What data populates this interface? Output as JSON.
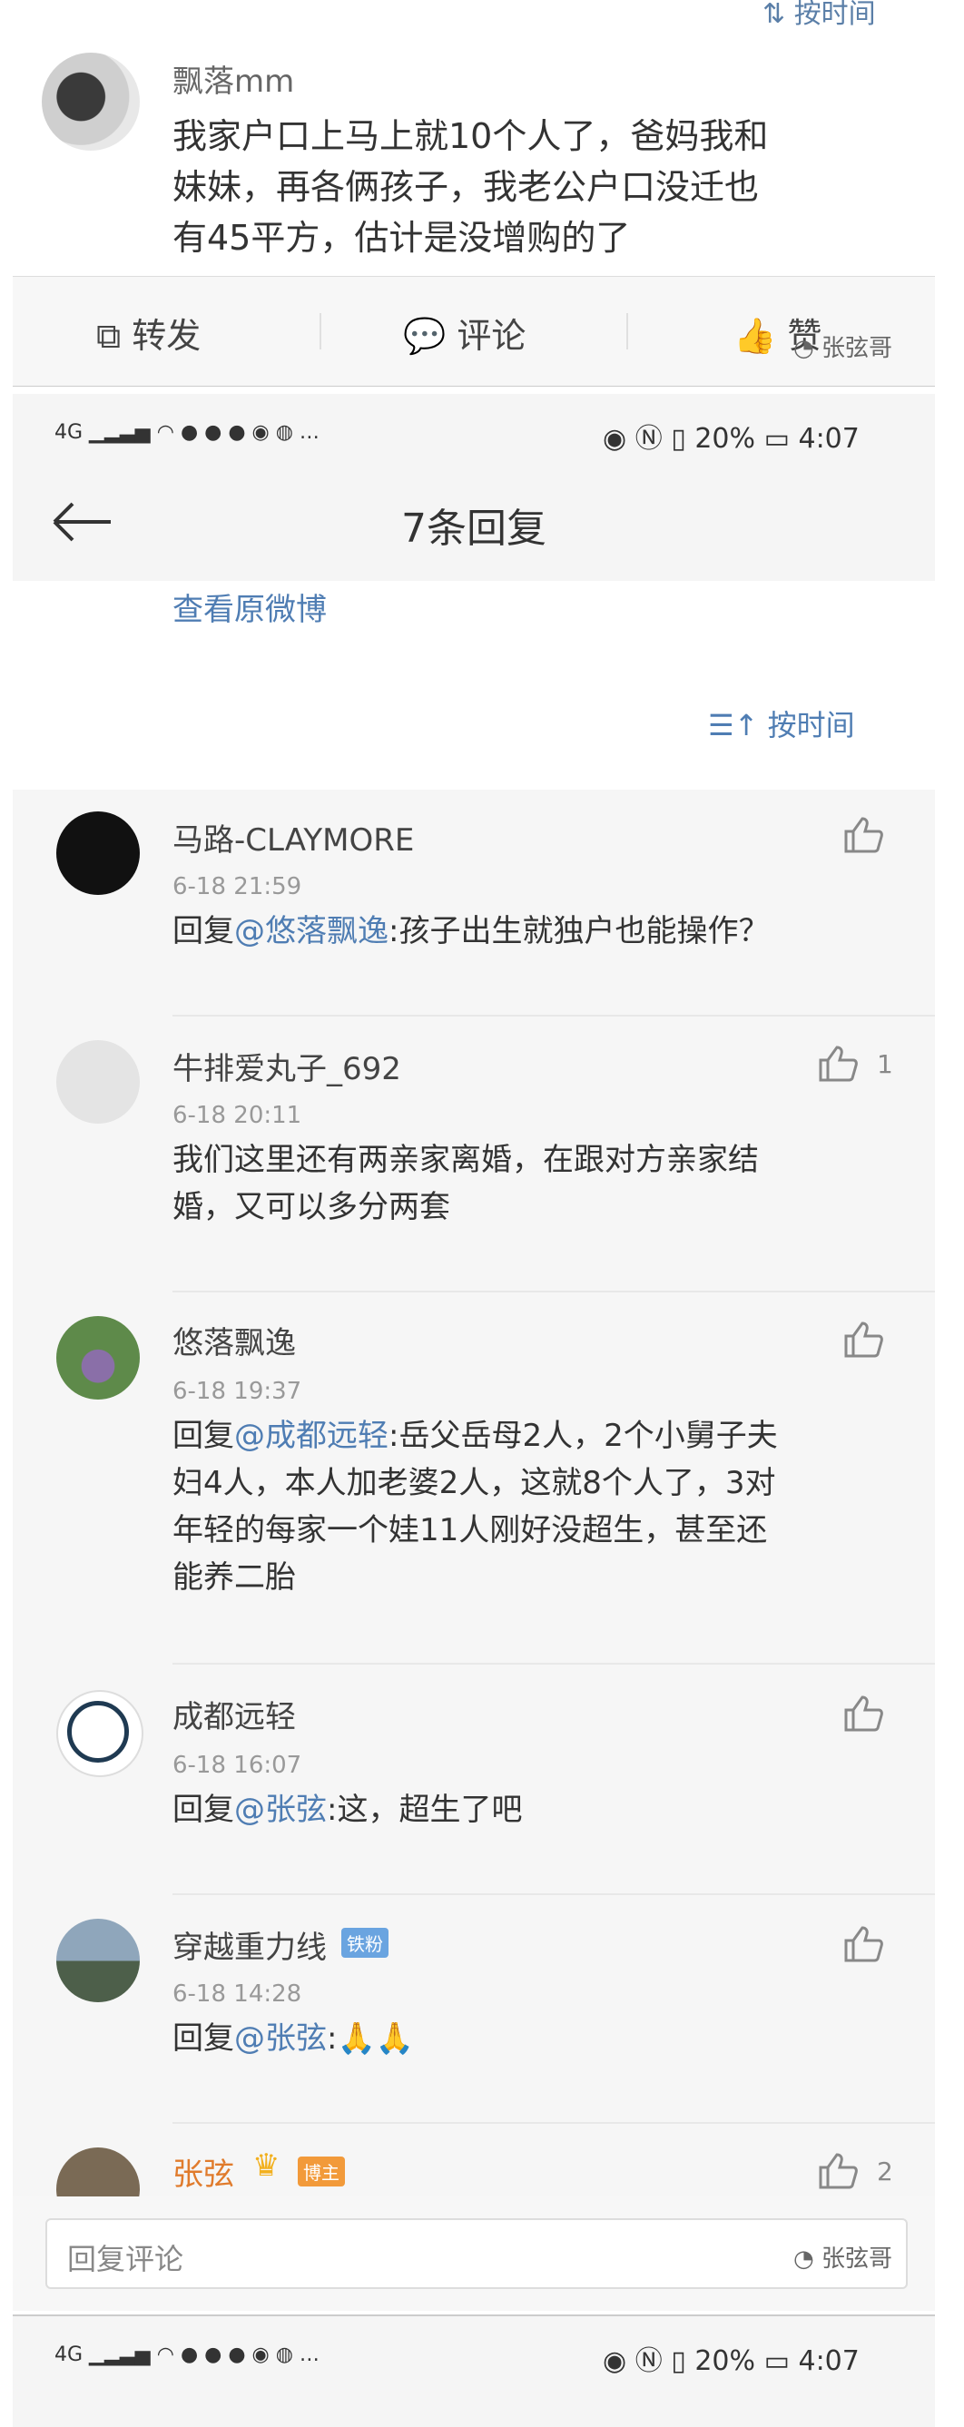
{
  "top": {
    "sort_label": "按时间"
  },
  "original_post": {
    "username": "飘落mm",
    "text_lines": [
      "我家户口上马上就10个人了，爸妈我和",
      "妹妹，再各俩孩子，我老公户口没迁也",
      "有45平方，估计是没增购的了"
    ]
  },
  "actions": {
    "forward": "转发",
    "comment": "评论",
    "like": "赞"
  },
  "watermark": "张弦哥",
  "status_bar": {
    "network": "4G",
    "battery": "20%",
    "time": "4:07"
  },
  "header": {
    "title": "7条回复"
  },
  "view_original": "查看原微博",
  "sort": {
    "label": "按时间"
  },
  "replies": [
    {
      "name": "马路-CLAYMORE",
      "time": "6-18 21:59",
      "prefix": "回复",
      "mention": "@悠落飘逸",
      "text_lines": [
        ":孩子出生就独户也能操作？"
      ],
      "likes": ""
    },
    {
      "name": "牛排爱丸子_692",
      "time": "6-18 20:11",
      "prefix": "",
      "mention": "",
      "text_lines": [
        "我们这里还有两亲家离婚，在跟对方亲家结",
        "婚，又可以多分两套"
      ],
      "likes": "1"
    },
    {
      "name": "悠落飘逸",
      "time": "6-18 19:37",
      "prefix": "回复",
      "mention": "@成都远轻",
      "text_lines": [
        ":岳父岳母2人，2个小舅子夫",
        "妇4人，本人加老婆2人，这就8个人了，3对",
        "年轻的每家一个娃11人刚好没超生，甚至还",
        "能养二胎"
      ],
      "likes": ""
    },
    {
      "name": "成都远轻",
      "time": "6-18 16:07",
      "prefix": "回复",
      "mention": "@张弦",
      "text_lines": [
        ":这，超生了吧"
      ],
      "likes": ""
    },
    {
      "name": "穿越重力线",
      "badge": "铁粉",
      "time": "6-18 14:28",
      "prefix": "回复",
      "mention": "@张弦",
      "text_lines": [
        ":🙏🙏"
      ],
      "likes": ""
    },
    {
      "name": "张弦",
      "badge": "博主",
      "likes": "2"
    }
  ],
  "reply_input": {
    "placeholder": "回复评论"
  },
  "colors": {
    "link": "#4f7db3",
    "author": "#e07b2c",
    "badge_fan": "#6aa4e0",
    "badge_owner": "#f29a3a"
  }
}
